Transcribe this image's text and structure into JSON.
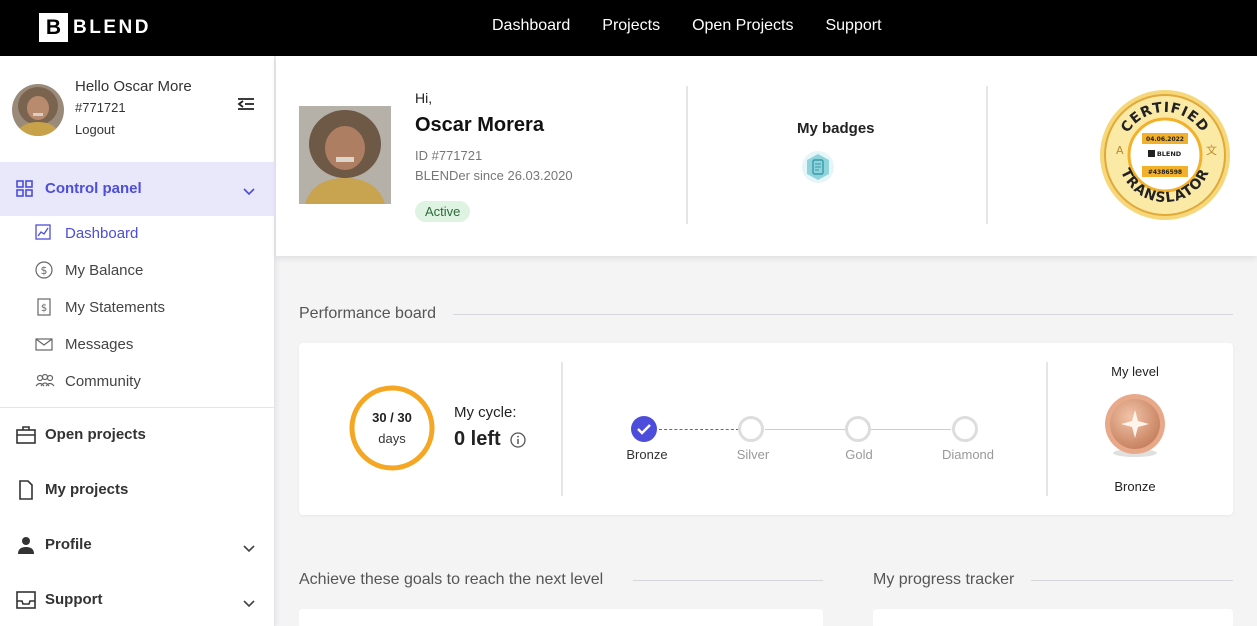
{
  "brand": {
    "logo_letter": "B",
    "name": "BLEND"
  },
  "topnav": [
    "Dashboard",
    "Projects",
    "Open Projects",
    "Support"
  ],
  "sidebar": {
    "greeting": "Hello Oscar More",
    "user_id": "#771721",
    "logout": "Logout",
    "control_panel": "Control panel",
    "sub_items": [
      {
        "label": "Dashboard",
        "icon": "chart-icon"
      },
      {
        "label": "My Balance",
        "icon": "dollar-circle-icon"
      },
      {
        "label": "My Statements",
        "icon": "statement-icon"
      },
      {
        "label": "Messages",
        "icon": "envelope-icon"
      },
      {
        "label": "Community",
        "icon": "people-icon"
      }
    ],
    "main_items": [
      {
        "label": "Open projects",
        "icon": "briefcase-icon"
      },
      {
        "label": "My projects",
        "icon": "document-icon"
      },
      {
        "label": "Profile",
        "icon": "person-icon"
      },
      {
        "label": "Support",
        "icon": "inbox-icon"
      }
    ]
  },
  "profile": {
    "hi": "Hi,",
    "name": "Oscar Morera",
    "id": "ID #771721",
    "since": "BLENDer since 26.03.2020",
    "status": "Active",
    "badges_title": "My badges"
  },
  "cert_seal": {
    "top_text": "CERTIFIED",
    "bottom_text": "TRANSLATOR",
    "date": "04.06.2022",
    "brand": "BLEND",
    "code": "#4386598",
    "color": "#f3b12b"
  },
  "performance": {
    "title": "Performance board",
    "ring_main": "30 / 30",
    "ring_sub": "days",
    "cycle_label": "My cycle:",
    "cycle_left": "0 left",
    "levels": [
      "Bronze",
      "Silver",
      "Gold",
      "Diamond"
    ],
    "current_level_index": 0,
    "my_level_title": "My level",
    "my_level": "Bronze",
    "ring_color": "#f5a623",
    "accent": "#4d4ddb"
  },
  "goals_title": "Achieve these goals to reach the next level",
  "tracker_title": "My progress tracker"
}
